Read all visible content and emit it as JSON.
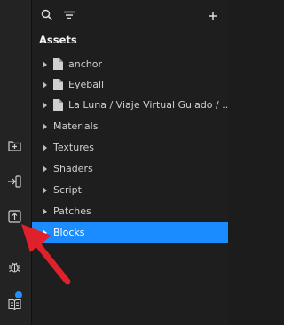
{
  "toolbar": {
    "search_icon": "search-icon",
    "filter_icon": "filter-icon",
    "add_icon": "plus-icon"
  },
  "rail": {
    "icons": [
      "add-folder-icon",
      "import-icon",
      "export-icon",
      "bug-icon",
      "docs-icon"
    ]
  },
  "assets": {
    "title": "Assets",
    "items": [
      {
        "label": "anchor",
        "type": "file"
      },
      {
        "label": "Eyeball",
        "type": "file"
      },
      {
        "label": "La Luna / Viaje Virtual Guiado / ...",
        "type": "file"
      },
      {
        "label": "Materials",
        "type": "folder"
      },
      {
        "label": "Textures",
        "type": "folder"
      },
      {
        "label": "Shaders",
        "type": "folder"
      },
      {
        "label": "Script",
        "type": "folder"
      },
      {
        "label": "Patches",
        "type": "folder"
      },
      {
        "label": "Blocks",
        "type": "folder",
        "selected": true
      }
    ]
  },
  "colors": {
    "accent": "#1a8cff",
    "annotation_arrow": "#e0202a",
    "notification": "#1e90ff"
  }
}
